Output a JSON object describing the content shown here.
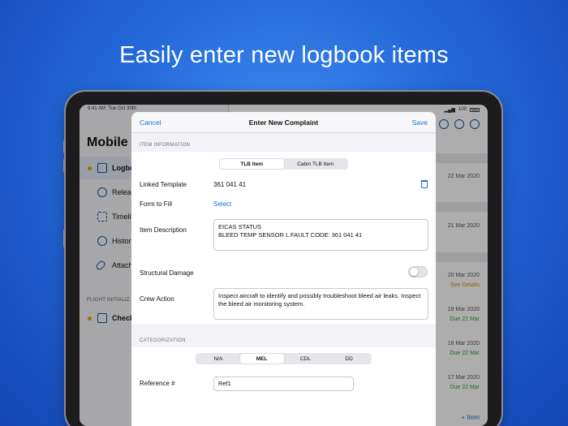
{
  "headline": "Easily enter new logbook items",
  "status_bar": {
    "time": "9:41 AM",
    "date": "Tue Oct 30th",
    "battery": "100"
  },
  "sidebar": {
    "title": "Mobile",
    "items": [
      {
        "label": "Logbo",
        "icon": "logbook-icon",
        "active": true,
        "dot": true
      },
      {
        "label": "Releas",
        "icon": "release-icon"
      },
      {
        "label": "Timeli",
        "icon": "timeline-icon"
      },
      {
        "label": "Histor",
        "icon": "history-icon"
      },
      {
        "label": "Attach",
        "icon": "attachment-icon"
      }
    ],
    "section_title": "FLIGHT INITIALIZ",
    "section_items": [
      {
        "label": "Check",
        "icon": "checklist-icon",
        "dot": true
      }
    ]
  },
  "list": {
    "rows": [
      {
        "date": "22 Mar 2020",
        "sub": ""
      },
      {
        "date": "21 Mar 2020",
        "sub": ""
      },
      {
        "date": "20 Mar 2020",
        "sub": "See Details"
      },
      {
        "date": "19 Mar 2020",
        "sub": "Due 22 Mar"
      },
      {
        "date": "18 Mar 2020",
        "sub": "Due 22 Mar"
      },
      {
        "date": "17 Mar 2020",
        "sub": "Due 22 Mar"
      }
    ],
    "add_label": "+ Item"
  },
  "modal": {
    "cancel": "Cancel",
    "title": "Enter New Complaint",
    "save": "Save",
    "item_info_header": "ITEM INFORMATION",
    "item_types": [
      "TLB Item",
      "Cabin TLB Item"
    ],
    "item_type_selected": "TLB Item",
    "linked_template_label": "Linked Template",
    "linked_template_value": "361 041 41",
    "form_label": "Form to Fill",
    "form_value": "Select",
    "description_label": "Item Description",
    "description_value": "EICAS STATUS\nBLEED TEMP SENSOR L FAULT CODE: 361 041 41",
    "structural_label": "Structural Damage",
    "structural_on": false,
    "crew_action_label": "Crew Action",
    "crew_action_value": "Inspect aircraft to identify and possibly troubleshoot bleed air leaks. Inspect the bleed air monitoring system.",
    "categorization_header": "CATEGORIZATION",
    "categories": [
      "N/A",
      "MEL",
      "CDL",
      "DD"
    ],
    "category_selected": "MEL",
    "reference_label": "Reference #",
    "reference_value": "Ref1"
  },
  "colors": {
    "accent": "#1a6fd9",
    "dot": "#f0a100",
    "due": "#2e9e3e",
    "details": "#e08a00"
  }
}
